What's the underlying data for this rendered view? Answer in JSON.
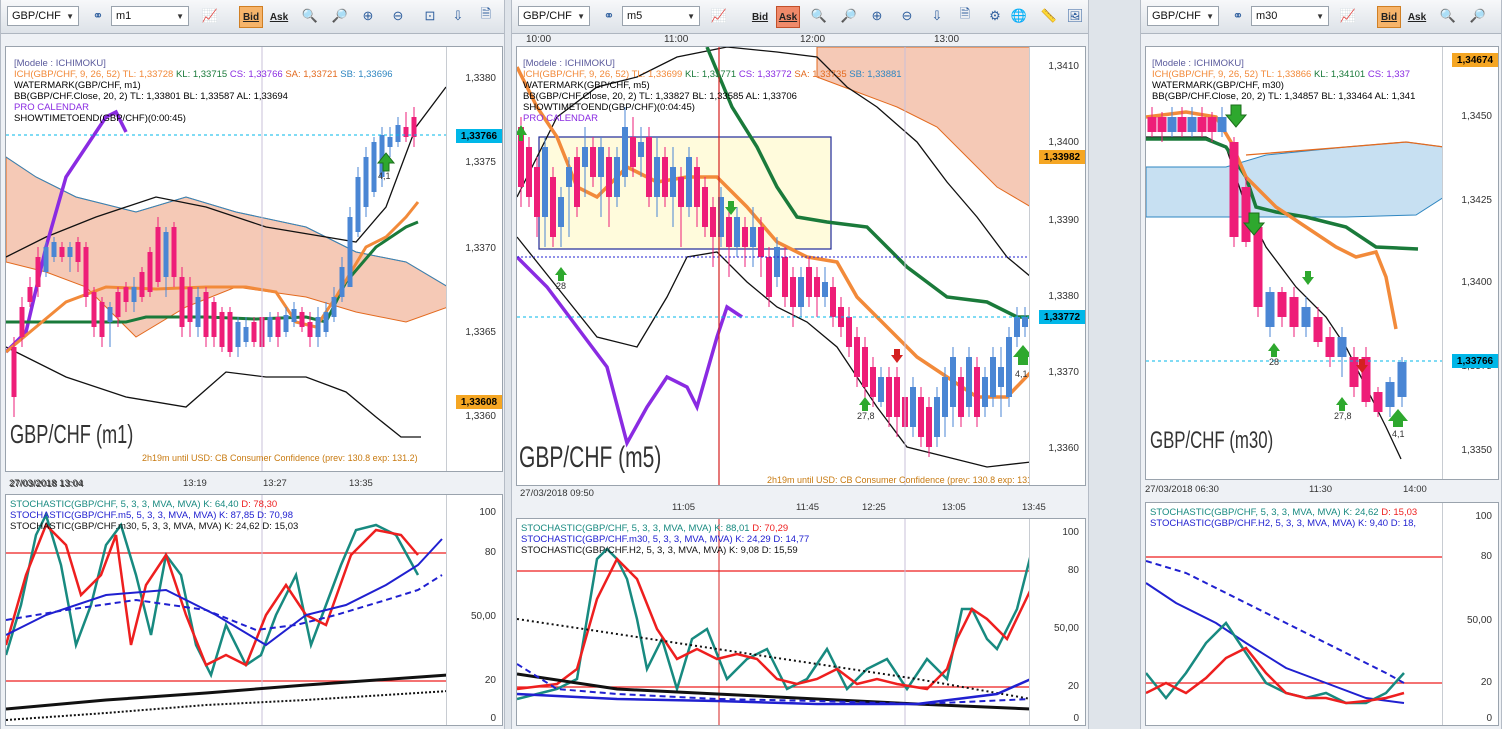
{
  "panels": [
    {
      "symbol": "GBP/CHF",
      "timeframe": "m1",
      "bid_label": "Bid",
      "ask_label": "Ask",
      "model": "[Modele : ICHIMOKU]",
      "ich_line": "ICH(GBP/CHF, 9, 26, 52)",
      "ich_tl": "TL: 1,33728",
      "ich_kl": "KL: 1,33715",
      "ich_cs": "CS: 1,33766",
      "ich_sa": "SA: 1,33721",
      "ich_sb": "SB: 1,33696",
      "watermark": "WATERMARK(GBP/CHF, m1)",
      "bb": "BB(GBP/CHF.Close, 20, 2)  TL: 1,33801  BL: 1,33587  AL: 1,33694",
      "pro_calendar": "PRO CALENDAR",
      "showtime": "SHOWTIMETOEND(GBP/CHF)(0:00:45)",
      "big": "GBP/CHF (m1)",
      "news": "2h19m until USD: CB Consumer Confidence (prev: 130.8 exp: 131.2)",
      "price_current": "1,33766",
      "price_low_badge": "1,33608",
      "y_ticks": [
        "1,3380",
        "1,3375",
        "1,3370",
        "1,3365",
        "1,3360"
      ],
      "x_ticks": [
        "27/03/2018 13:04",
        "13:19",
        "13:27",
        "13:35"
      ],
      "arrow_label": "4,1",
      "stoch1": "STOCHASTIC(GBP/CHF, 5, 3, 3, MVA, MVA)  K: 64,40",
      "stoch1_d": "D: 78,30",
      "stoch2": "STOCHASTIC(GBP/CHF.m5, 5, 3, 3, MVA, MVA)  K: 87,85  D: 70,98",
      "stoch3": "STOCHASTIC(GBP/CHF.m30, 5, 3, 3, MVA, MVA)  K: 24,62  D: 15,03",
      "stoch_ticks": [
        "100",
        "80",
        "50,00",
        "20",
        "0"
      ]
    },
    {
      "symbol": "GBP/CHF",
      "timeframe": "m5",
      "bid_label": "Bid",
      "ask_label": "Ask",
      "time_top": [
        "10:00",
        "11:00",
        "12:00",
        "13:00"
      ],
      "model": "[Modele : ICHIMOKU]",
      "ich_line": "ICH(GBP/CHF, 9, 26, 52)",
      "ich_tl": "TL: 1,33699",
      "ich_kl": "KL: 1,33771",
      "ich_cs": "CS: 1,33772",
      "ich_sa": "SA: 1,33735",
      "ich_sb": "SB: 1,33881",
      "watermark": "WATERMARK(GBP/CHF, m5)",
      "bb": "BB(GBP/CHF.Close, 20, 2)  TL: 1,33827  BL: 1,33585  AL: 1,33706",
      "showtime": "SHOWTIMETOEND(GBP/CHF)(0:04:45)",
      "pro_calendar": "PRO CALENDAR",
      "big": "GBP/CHF (m5)",
      "news": "2h19m until USD: CB Consumer Confidence (prev: 130.8 exp: 131.2)",
      "price_current": "1,33772",
      "price_high_badge": "1,33982",
      "y_ticks": [
        "1,3410",
        "1,3400",
        "1,3390",
        "1,3380",
        "1,3370",
        "1,3360"
      ],
      "x_ticks": [
        "27/03/2018 09:50",
        "11:05",
        "11:45",
        "12:25",
        "13:05",
        "13:45"
      ],
      "arrow_labels": [
        "28",
        "27,8",
        "4,1"
      ],
      "stoch1": "STOCHASTIC(GBP/CHF, 5, 3, 3, MVA, MVA)  K: 88,01",
      "stoch1_d": "D: 70,29",
      "stoch2": "STOCHASTIC(GBP/CHF.m30, 5, 3, 3, MVA, MVA)  K: 24,29  D: 14,77",
      "stoch3": "STOCHASTIC(GBP/CHF.H2, 5, 3, 3, MVA, MVA)  K: 9,08  D: 15,59",
      "stoch_ticks": [
        "100",
        "80",
        "50,00",
        "20",
        "0"
      ]
    },
    {
      "symbol": "GBP/CHF",
      "timeframe": "m30",
      "bid_label": "Bid",
      "ask_label": "Ask",
      "model": "[Modele : ICHIMOKU]",
      "ich_line": "ICH(GBP/CHF, 9, 26, 52)",
      "ich_tl": "TL: 1,33866",
      "ich_kl": "KL: 1,34101",
      "ich_cs": "CS: 1,337",
      "watermark": "WATERMARK(GBP/CHF, m30)",
      "bb": "BB(GBP/CHF.Close, 20, 2)  TL: 1,34857  BL: 1,33464  AL: 1,341",
      "big": "GBP/CHF (m30)",
      "price_current": "1,33766",
      "price_high_badge": "1,34674",
      "y_ticks": [
        "1,3450",
        "1,3425",
        "1,3400",
        "1,3375",
        "1,3350"
      ],
      "x_ticks": [
        "27/03/2018 06:30",
        "11:30",
        "14:00"
      ],
      "arrow_labels": [
        "28",
        "27,8",
        "4,1"
      ],
      "stoch1": "STOCHASTIC(GBP/CHF, 5, 3, 3, MVA, MVA)  K: 24,62",
      "stoch1_d": "D: 15,03",
      "stoch2": "STOCHASTIC(GBP/CHF.H2, 5, 3, 3, MVA, MVA)  K: 9,40  D: 18,",
      "stoch_ticks": [
        "100",
        "80",
        "50,00",
        "20",
        "0"
      ]
    }
  ],
  "colors": {
    "bull": "#4a86d4",
    "bear": "#ee1e78",
    "kijun": "#1a7a3a",
    "tenkan": "#f28a3a",
    "chikou": "#8a2be2",
    "cloud_bear": "#f5c9b6",
    "cloud_bull": "#c7e0f2",
    "current_price": "#00b7e8",
    "badge_orange": "#f5a623",
    "stoch_k": "#188a80",
    "stoch_d": "#ee1f1f",
    "stoch_blue": "#2020d0"
  }
}
